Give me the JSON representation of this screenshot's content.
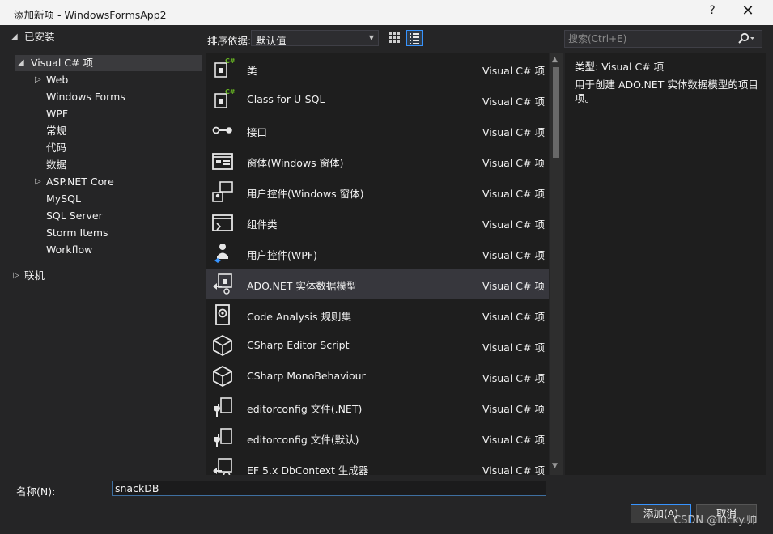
{
  "window": {
    "title": "添加新项 - WindowsFormsApp2",
    "help_label": "?",
    "close_label": "✕"
  },
  "tree": {
    "installed": "已安装",
    "visual_csharp": "Visual C# 项",
    "children": [
      "Web",
      "Windows Forms",
      "WPF",
      "常规",
      "代码",
      "数据",
      "ASP.NET Core",
      "MySQL",
      "SQL Server",
      "Storm Items",
      "Workflow"
    ],
    "online": "联机"
  },
  "toolbar": {
    "sort_label": "排序依据:",
    "sort_value": "默认值"
  },
  "search": {
    "placeholder": "搜索(Ctrl+E)"
  },
  "items": [
    {
      "name": "类",
      "type": "Visual C# 项",
      "icon": "class-icon"
    },
    {
      "name": "Class for U-SQL",
      "type": "Visual C# 项",
      "icon": "class-icon"
    },
    {
      "name": "接口",
      "type": "Visual C# 项",
      "icon": "interface-icon"
    },
    {
      "name": "窗体(Windows 窗体)",
      "type": "Visual C# 项",
      "icon": "form-icon"
    },
    {
      "name": "用户控件(Windows 窗体)",
      "type": "Visual C# 项",
      "icon": "user-control-icon"
    },
    {
      "name": "组件类",
      "type": "Visual C# 项",
      "icon": "component-icon"
    },
    {
      "name": "用户控件(WPF)",
      "type": "Visual C# 项",
      "icon": "user-control-wpf-icon"
    },
    {
      "name": "ADO.NET 实体数据模型",
      "type": "Visual C# 项",
      "icon": "entity-model-icon"
    },
    {
      "name": "Code Analysis 规则集",
      "type": "Visual C# 项",
      "icon": "ruleset-icon"
    },
    {
      "name": "CSharp Editor Script",
      "type": "Visual C# 项",
      "icon": "cube-icon"
    },
    {
      "name": "CSharp MonoBehaviour",
      "type": "Visual C# 项",
      "icon": "cube-icon"
    },
    {
      "name": "editorconfig 文件(.NET)",
      "type": "Visual C# 项",
      "icon": "wrench-file-icon"
    },
    {
      "name": "editorconfig 文件(默认)",
      "type": "Visual C# 项",
      "icon": "wrench-file-icon"
    },
    {
      "name": "EF 5.x DbContext 生成器",
      "type": "Visual C# 项",
      "icon": "generator-icon"
    }
  ],
  "selected_index": 7,
  "description": {
    "type_label": "类型:",
    "type_value": "Visual C# 项",
    "text": "用于创建 ADO.NET 实体数据模型的项目项。"
  },
  "bottom": {
    "name_label": "名称(N):",
    "name_value": "snackDB",
    "add_label": "添加(A)",
    "cancel_label": "取消"
  },
  "watermark": "CSDN @lucky.帅",
  "colors": {
    "accent": "#3794ff",
    "csharp_badge": "#68b723",
    "background": "#252526"
  }
}
